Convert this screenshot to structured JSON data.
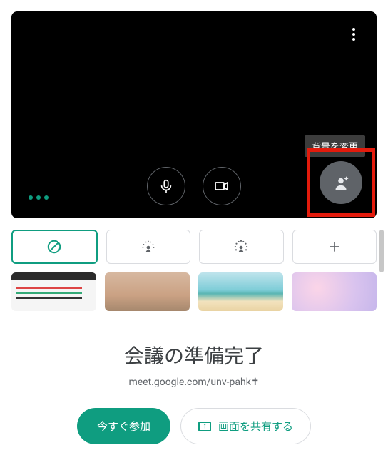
{
  "video": {
    "tooltip_change_bg": "背景を変更"
  },
  "bg_options": {
    "none_label": "なし",
    "blur_light_label": "弱いぼかし",
    "blur_strong_label": "強いぼかし",
    "add_label": "追加"
  },
  "meeting": {
    "title": "会議の準備完了",
    "link": "meet.google.com/unv-pahk",
    "link_suffix": "✝"
  },
  "actions": {
    "join_now": "今すぐ参加",
    "share_screen": "画面を共有する"
  }
}
